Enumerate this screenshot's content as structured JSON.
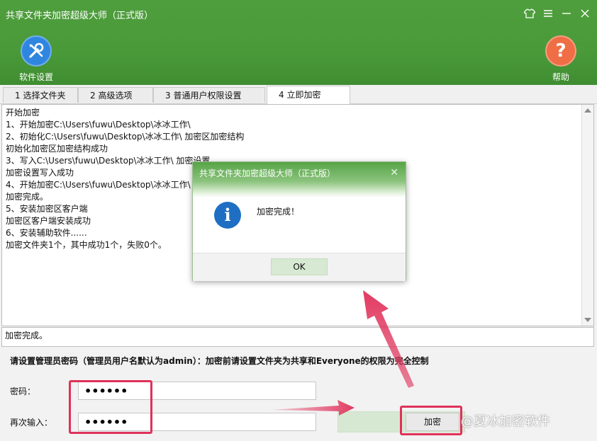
{
  "app": {
    "title": "共享文件夹加密超级大师（正式版）"
  },
  "toolbar": {
    "settings_label": "软件设置",
    "settings_icon": "wrench-screwdriver-icon",
    "help_label": "帮助",
    "help_icon": "question-icon"
  },
  "tabs": [
    {
      "label": "1 选择文件夹",
      "active": false
    },
    {
      "label": "2 高级选项",
      "active": false
    },
    {
      "label": "3 普通用户权限设置",
      "active": false
    },
    {
      "label": "4 立即加密",
      "active": true
    }
  ],
  "log": {
    "lines": [
      "开始加密",
      "1、开始加密C:\\Users\\fuwu\\Desktop\\冰冰工作\\",
      "2、初始化C:\\Users\\fuwu\\Desktop\\冰冰工作\\ 加密区加密结构",
      "初始化加密区加密结构成功",
      "3、写入C:\\Users\\fuwu\\Desktop\\冰冰工作\\ 加密设置",
      "加密设置写入成功",
      "4、开始加密C:\\Users\\fuwu\\Desktop\\冰冰工作\\",
      "加密完成。",
      "5、安装加密区客户端",
      "加密区客户端安装成功",
      "6、安装辅助软件......",
      "加密文件夹1个，其中成功1个，失败0个。"
    ]
  },
  "status": {
    "text": "加密完成。"
  },
  "form": {
    "note": "请设置管理员密码（管理员用户名默认为admin）：加密前请设置文件夹为共享和Everyone的权限为完全控制",
    "password_label": "密码：",
    "password_value": "••••••",
    "confirm_label": "再次输入：",
    "confirm_value": "••••••",
    "encrypt_button": "加密"
  },
  "watermark": {
    "text": "@夏冰加密软件"
  },
  "dialog": {
    "title": "共享文件夹加密超级大师（正式版）",
    "message": "加密完成！",
    "ok_label": "OK",
    "icon": "info-icon"
  },
  "colors": {
    "header_green": "#4a9a39",
    "settings_blue": "#2f86e0",
    "help_orange": "#ef6e45",
    "highlight_red": "#e0315a",
    "info_blue": "#1e6fc4"
  }
}
